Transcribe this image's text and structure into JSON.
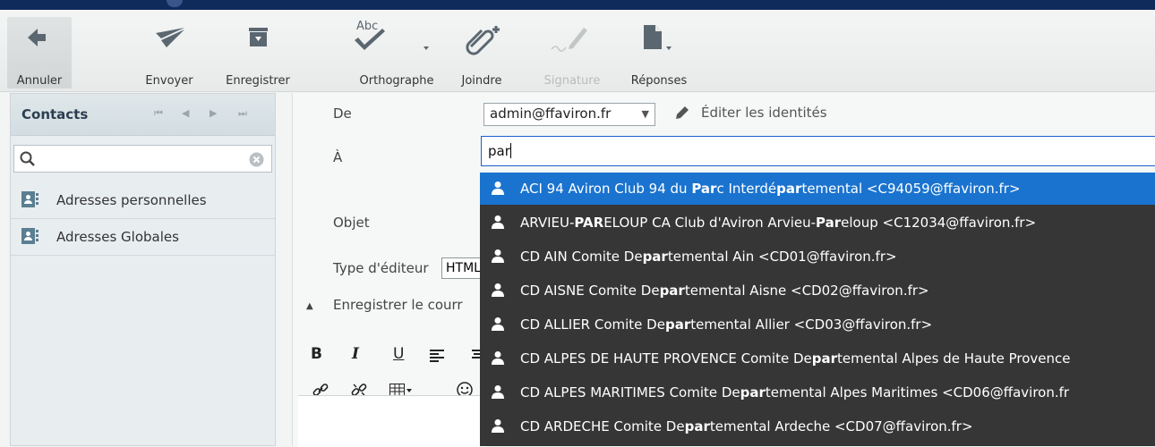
{
  "toolbar": {
    "cancel": "Annuler",
    "send": "Envoyer",
    "save": "Enregistrer",
    "spell": "Orthographe",
    "spell_icon_text": "Abc",
    "attach": "Joindre",
    "signature": "Signature",
    "responses": "Réponses"
  },
  "sidebar": {
    "title": "Contacts",
    "pager": [
      "⏮",
      "◀",
      "▶",
      "⏭"
    ],
    "items": [
      {
        "label": "Adresses personnelles"
      },
      {
        "label": "Adresses Globales"
      }
    ]
  },
  "compose": {
    "from_label": "De",
    "from_value": "admin@ffaviron.fr",
    "edit_identities": "Éditer les identités",
    "to_label": "À",
    "to_value": "par",
    "subject_label": "Objet",
    "editor_type_label": "Type d'éditeur",
    "editor_type_value": "HTML",
    "save_sent_label": "Enregistrer le courr",
    "format_buttons": {
      "bold": "B",
      "italic": "I",
      "underline": "U"
    }
  },
  "autocomplete": [
    {
      "parts": [
        [
          "ACI 94 Aviron Club 94 du ",
          false
        ],
        [
          "Par",
          true
        ],
        [
          "c Interdé",
          false
        ],
        [
          "par",
          true
        ],
        [
          "temental <C94059@ffaviron.fr>",
          false
        ]
      ]
    },
    {
      "parts": [
        [
          "ARVIEU-",
          false
        ],
        [
          "PAR",
          true
        ],
        [
          "ELOUP CA Club d'Aviron Arvieu-",
          false
        ],
        [
          "Par",
          true
        ],
        [
          "eloup <C12034@ffaviron.fr>",
          false
        ]
      ]
    },
    {
      "parts": [
        [
          "CD AIN Comite De",
          false
        ],
        [
          "par",
          true
        ],
        [
          "temental Ain <CD01@ffaviron.fr>",
          false
        ]
      ]
    },
    {
      "parts": [
        [
          "CD AISNE Comite De",
          false
        ],
        [
          "par",
          true
        ],
        [
          "temental Aisne <CD02@ffaviron.fr>",
          false
        ]
      ]
    },
    {
      "parts": [
        [
          "CD ALLIER Comite De",
          false
        ],
        [
          "par",
          true
        ],
        [
          "temental Allier <CD03@ffaviron.fr>",
          false
        ]
      ]
    },
    {
      "parts": [
        [
          "CD ALPES DE HAUTE PROVENCE Comite De",
          false
        ],
        [
          "par",
          true
        ],
        [
          "temental Alpes de Haute Provence",
          false
        ]
      ]
    },
    {
      "parts": [
        [
          "CD ALPES MARITIMES Comite De",
          false
        ],
        [
          "par",
          true
        ],
        [
          "temental Alpes Maritimes <CD06@ffaviron.fr",
          false
        ]
      ]
    },
    {
      "parts": [
        [
          "CD ARDECHE Comite De",
          false
        ],
        [
          "par",
          true
        ],
        [
          "temental Ardeche <CD07@ffaviron.fr>",
          false
        ]
      ]
    }
  ],
  "colors": {
    "accent": "#1a73cf",
    "dropdown_bg": "#363636",
    "topbar": "#0f2b5b"
  }
}
